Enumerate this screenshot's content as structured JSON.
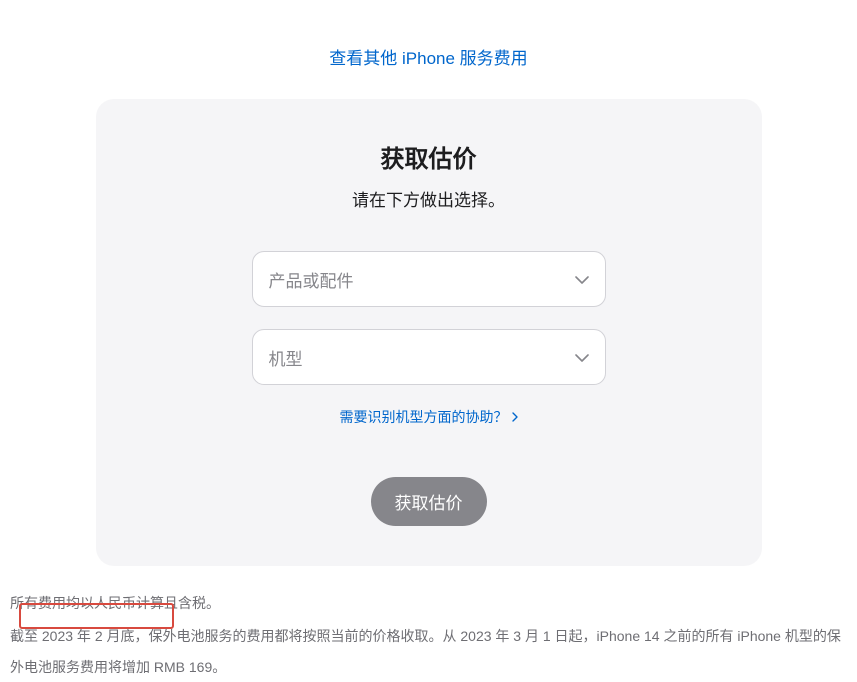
{
  "topLink": {
    "label": "查看其他 iPhone 服务费用"
  },
  "card": {
    "title": "获取估价",
    "subtitle": "请在下方做出选择。",
    "selects": {
      "product": {
        "placeholder": "产品或配件"
      },
      "model": {
        "placeholder": "机型"
      }
    },
    "helpLink": {
      "label": "需要识别机型方面的协助？"
    },
    "submit": {
      "label": "获取估价"
    }
  },
  "footer": {
    "line1": "所有费用均以人民币计算且含税。",
    "line2": "截至 2023 年 2 月底，保外电池服务的费用都将按照当前的价格收取。从 2023 年 3 月 1 日起，iPhone 14 之前的所有 iPhone 机型的保外电池服务费用将增加 RMB 169。"
  }
}
